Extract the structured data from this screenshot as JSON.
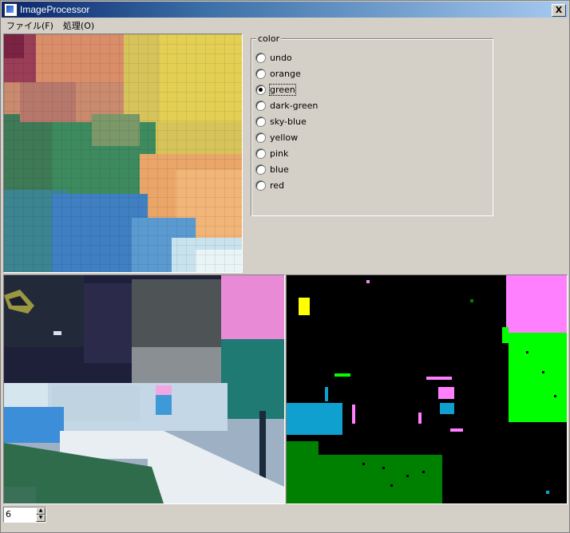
{
  "window": {
    "title": "ImageProcessor",
    "close_label": "X"
  },
  "menu": [
    {
      "label": "ファイル(F)"
    },
    {
      "label": "処理(O)"
    }
  ],
  "color_group": {
    "legend": "color",
    "selected": "green",
    "options": [
      "undo",
      "orange",
      "green",
      "dark-green",
      "sky-blue",
      "yellow",
      "pink",
      "blue",
      "red"
    ]
  },
  "threshold": {
    "value": "6"
  },
  "colors": {
    "window_bg": "#d4d0c8",
    "title_start": "#0a246a",
    "mask_bg": "#000000",
    "mask_green": "#00ff00",
    "mask_pink": "#ff80ff",
    "mask_skyblue": "#10a0d0",
    "mask_darkgreen": "#008000",
    "mask_yellow": "#ffff00"
  }
}
